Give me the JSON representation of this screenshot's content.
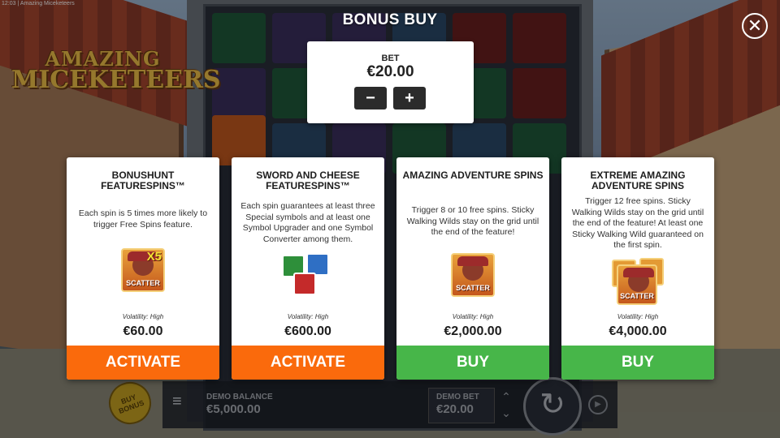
{
  "status_bar": {
    "time": "12:03",
    "app_title": "Amazing Miceketeers"
  },
  "logo": {
    "line1": "AMAZING",
    "line2": "MICEKETEERS"
  },
  "overlay": {
    "title": "BONUS BUY",
    "close_symbol": "✕",
    "bet": {
      "label": "BET",
      "value": "€20.00",
      "minus": "−",
      "plus": "+"
    }
  },
  "cards": [
    {
      "title": "BONUSHUNT FEATURESPINS™",
      "description": "Each spin is 5 times more likely to trigger Free Spins feature.",
      "icon": "scatter-x5-icon",
      "icon_text": "SCATTER",
      "icon_badge": "X5",
      "volatility": "Volatility: High",
      "price": "€60.00",
      "button": "ACTIVATE",
      "button_color": "#fa6a0c"
    },
    {
      "title": "SWORD AND CHEESE FEATURESPINS™",
      "description": "Each spin guarantees at least three Special symbols and at least one Symbol Upgrader and one Symbol Converter among them.",
      "icon": "special-symbols-icon",
      "volatility": "Volatility: High",
      "price": "€600.00",
      "button": "ACTIVATE",
      "button_color": "#fa6a0c"
    },
    {
      "title": "AMAZING ADVENTURE SPINS",
      "description": "Trigger 8 or 10 free spins. Sticky Walking Wilds stay on the grid until the end of the feature!",
      "icon": "scatter-icon",
      "icon_text": "SCATTER",
      "volatility": "Volatility: High",
      "price": "€2,000.00",
      "button": "BUY",
      "button_color": "#47b649"
    },
    {
      "title": "EXTREME AMAZING ADVENTURE SPINS",
      "description": "Trigger 12 free spins. Sticky Walking Wilds stay on the grid until the end of the feature! At least one Sticky Walking Wild guaranteed on the first spin.",
      "icon": "scatter-stack-icon",
      "icon_text": "SCATTER",
      "volatility": "Volatility: High",
      "price": "€4,000.00",
      "button": "BUY",
      "button_color": "#47b649"
    }
  ],
  "hud": {
    "buy_bonus_label": "BUY BONUS",
    "demo_balance_label": "DEMO BALANCE",
    "demo_balance_value": "€5,000.00",
    "demo_bet_label": "DEMO BET",
    "demo_bet_value": "€20.00"
  }
}
